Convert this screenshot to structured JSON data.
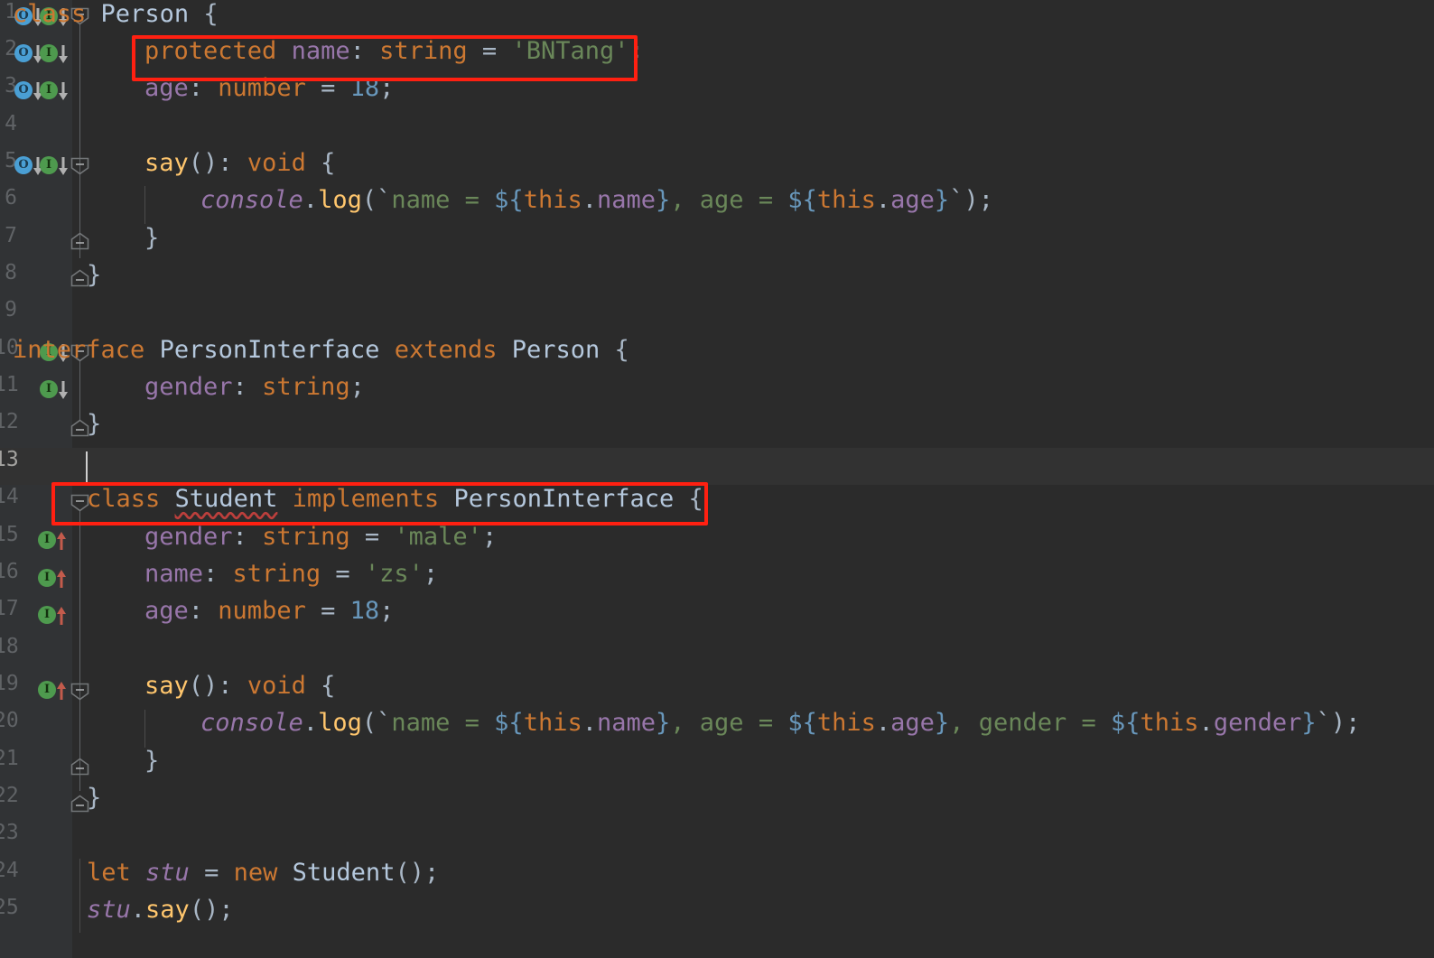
{
  "editor": {
    "language": "TypeScript",
    "theme": "Darcula",
    "background": "#2b2b2b",
    "gutter_background": "#313335",
    "current_line": 13,
    "current_line_background": "#323232",
    "annotation_color": "#ff2011"
  },
  "lines": [
    {
      "number": "1",
      "text": "class Person {"
    },
    {
      "number": "2",
      "text": "    protected name: string = 'BNTang';"
    },
    {
      "number": "3",
      "text": "    age: number = 18;"
    },
    {
      "number": "4",
      "text": ""
    },
    {
      "number": "5",
      "text": "    say(): void {"
    },
    {
      "number": "6",
      "text": "        console.log(`name = ${this.name}, age = ${this.age}`);"
    },
    {
      "number": "7",
      "text": "    }"
    },
    {
      "number": "8",
      "text": "}"
    },
    {
      "number": "9",
      "text": ""
    },
    {
      "number": "10",
      "text": "interface PersonInterface extends Person {"
    },
    {
      "number": "11",
      "text": "    gender: string;"
    },
    {
      "number": "12",
      "text": "}"
    },
    {
      "number": "13",
      "text": ""
    },
    {
      "number": "14",
      "text": "class Student implements PersonInterface {"
    },
    {
      "number": "15",
      "text": "    gender: string = 'male';"
    },
    {
      "number": "16",
      "text": "    name: string = 'zs';"
    },
    {
      "number": "17",
      "text": "    age: number = 18;"
    },
    {
      "number": "18",
      "text": ""
    },
    {
      "number": "19",
      "text": "    say(): void {"
    },
    {
      "number": "20",
      "text": "        console.log(`name = ${this.name}, age = ${this.age}, gender = ${this.gender}`);"
    },
    {
      "number": "21",
      "text": "    }"
    },
    {
      "number": "22",
      "text": "}"
    },
    {
      "number": "23",
      "text": ""
    },
    {
      "number": "24",
      "text": "let stu = new Student();"
    },
    {
      "number": "25",
      "text": "stu.say();"
    }
  ],
  "tokens": {
    "l1": {
      "kw_class": "class",
      "name": "Person",
      "brace": " {"
    },
    "l2": {
      "kw_protected": "protected",
      "field": "name",
      "colon": ": ",
      "kw_string": "string",
      "eq": " = ",
      "str": "'BNTang'",
      "semi": ";"
    },
    "l3": {
      "field": "age",
      "colon": ": ",
      "kw_number": "number",
      "eq": " = ",
      "num": "18",
      "semi": ";"
    },
    "l5": {
      "fn": "say",
      "parens": "(): ",
      "kw_void": "void",
      "brace": " {"
    },
    "l6": {
      "console": "console",
      "dot": ".",
      "log": "log",
      "open": "(",
      "tick1": "`",
      "t_name": "name = ",
      "sub1": "${",
      "this1": "this",
      "d1": ".",
      "p1": "name",
      "cb1": "}",
      "t_mid": ", age = ",
      "sub2": "${",
      "this2": "this",
      "d2": ".",
      "p2": "age",
      "cb2": "}",
      "tick2": "`",
      "close": ");"
    },
    "l7": {
      "text": "}"
    },
    "l8": {
      "text": "}"
    },
    "l10": {
      "kw_interface": "interface",
      "name": "PersonInterface",
      "kw_extends": "extends",
      "base": "Person",
      "brace": " {"
    },
    "l11": {
      "field": "gender",
      "colon": ": ",
      "kw_string": "string",
      "semi": ";"
    },
    "l12": {
      "text": "}"
    },
    "l14": {
      "kw_class": "class",
      "name": "Student",
      "kw_implements": "implements",
      "iface": "PersonInterface",
      "brace": " {"
    },
    "l15": {
      "field": "gender",
      "colon": ": ",
      "kw_string": "string",
      "eq": " = ",
      "str": "'male'",
      "semi": ";"
    },
    "l16": {
      "field": "name",
      "colon": ": ",
      "kw_string": "string",
      "eq": " = ",
      "str": "'zs'",
      "semi": ";"
    },
    "l17": {
      "field": "age",
      "colon": ": ",
      "kw_number": "number",
      "eq": " = ",
      "num": "18",
      "semi": ";"
    },
    "l19": {
      "fn": "say",
      "parens": "(): ",
      "kw_void": "void",
      "brace": " {"
    },
    "l20": {
      "console": "console",
      "dot": ".",
      "log": "log",
      "open": "(",
      "tick1": "`",
      "t_name": "name = ",
      "sub1": "${",
      "this1": "this",
      "d1": ".",
      "p1": "name",
      "cb1": "}",
      "t_mid": ", age = ",
      "sub2": "${",
      "this2": "this",
      "d2": ".",
      "p2": "age",
      "cb2": "}",
      "t_mid2": ", gender = ",
      "sub3": "${",
      "this3": "this",
      "d3": ".",
      "p3": "gender",
      "cb3": "}",
      "tick2": "`",
      "close": ");"
    },
    "l21": {
      "text": "}"
    },
    "l22": {
      "text": "}"
    },
    "l24": {
      "kw_let": "let",
      "var": "stu",
      "eq": " = ",
      "kw_new": "new",
      "cls": "Student",
      "call": "();"
    },
    "l25": {
      "var": "stu",
      "dot": ".",
      "fn": "say",
      "call": "();"
    }
  },
  "gutter_markers": [
    {
      "line": 1,
      "icons": [
        "overridden-icon",
        "implemented-icon"
      ],
      "direction": "down"
    },
    {
      "line": 2,
      "icons": [
        "overridden-icon",
        "implemented-icon"
      ],
      "direction": "down"
    },
    {
      "line": 3,
      "icons": [
        "overridden-icon",
        "implemented-icon"
      ],
      "direction": "down"
    },
    {
      "line": 5,
      "icons": [
        "overridden-icon",
        "implemented-icon"
      ],
      "direction": "down"
    },
    {
      "line": 10,
      "icons": [
        "implemented-icon"
      ],
      "direction": "down"
    },
    {
      "line": 11,
      "icons": [
        "implemented-icon"
      ],
      "direction": "down"
    },
    {
      "line": 15,
      "icons": [
        "implementing-icon"
      ],
      "direction": "up"
    },
    {
      "line": 16,
      "icons": [
        "implementing-icon"
      ],
      "direction": "up"
    },
    {
      "line": 17,
      "icons": [
        "implementing-icon"
      ],
      "direction": "up"
    },
    {
      "line": 19,
      "icons": [
        "implementing-icon"
      ],
      "direction": "up"
    }
  ],
  "annotations": [
    {
      "id": "highlight-protected-name",
      "target_line": 2,
      "label": "protected name: string = 'BNTang';"
    },
    {
      "id": "highlight-class-student",
      "target_line": 14,
      "label": "class Student implements PersonInterface {"
    }
  ],
  "error": {
    "token": "Student",
    "line": 14,
    "kind": "wavy-underline",
    "color": "#bc3f3c"
  },
  "caret": {
    "line": 13,
    "column": 1
  },
  "colors": {
    "keyword": "#cc7832",
    "class_name": "#b5c8dd",
    "field": "#9876aa",
    "number": "#6897bb",
    "string": "#6a8759",
    "function": "#ffc66d",
    "default": "#a9b7c6",
    "gutter_blue": "#4a9fd4",
    "gutter_green": "#4e9a4e"
  }
}
